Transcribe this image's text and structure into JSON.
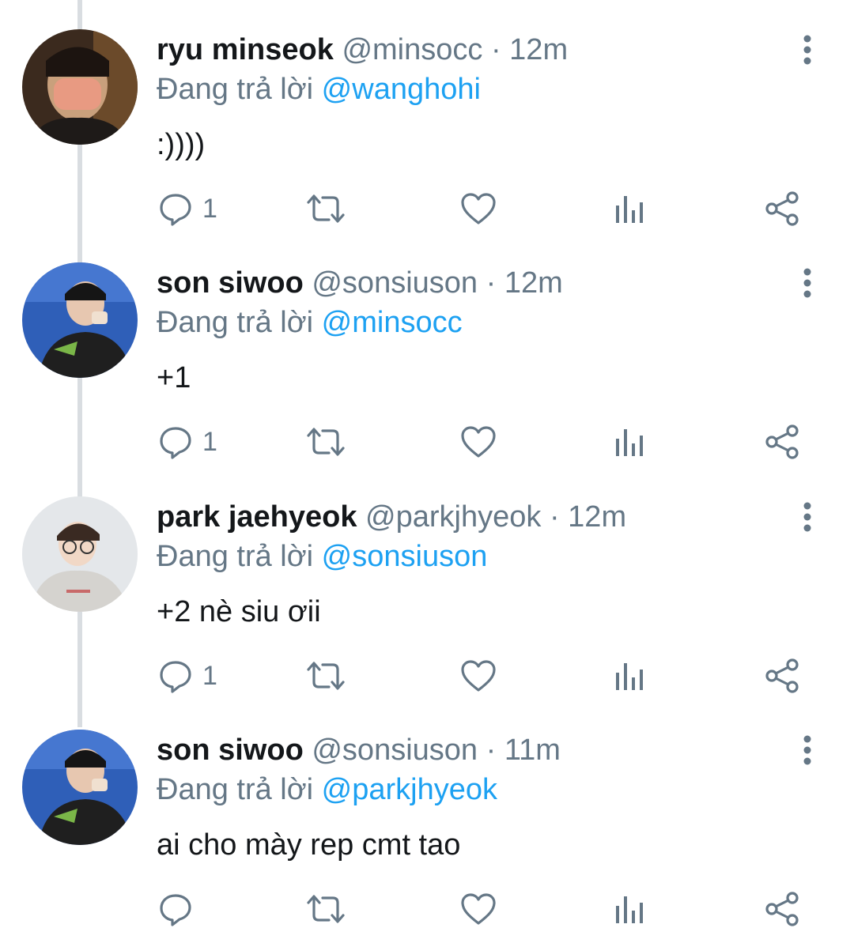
{
  "tweets": [
    {
      "name": "ryu minseok",
      "handle": "@minsocc",
      "sep": "·",
      "time": "12m",
      "reply_prefix": "Đang trả lời",
      "reply_to": "@wanghohi",
      "text": ":))))",
      "reply_count": "1"
    },
    {
      "name": "son siwoo",
      "handle": "@sonsiuson",
      "sep": "·",
      "time": "12m",
      "reply_prefix": "Đang trả lời",
      "reply_to": "@minsocc",
      "text": "+1",
      "reply_count": "1"
    },
    {
      "name": "park jaehyeok",
      "handle": "@parkjhyeok",
      "sep": "·",
      "time": "12m",
      "reply_prefix": "Đang trả lời",
      "reply_to": "@sonsiuson",
      "text": "+2 nè siu ơii",
      "reply_count": "1"
    },
    {
      "name": "son siwoo",
      "handle": "@sonsiuson",
      "sep": "·",
      "time": "11m",
      "reply_prefix": "Đang trả lời",
      "reply_to": "@parkjhyeok",
      "text": "ai cho mày rep cmt tao",
      "reply_count": ""
    }
  ],
  "icons": {
    "reply": "reply-icon",
    "retweet": "retweet-icon",
    "like": "like-icon",
    "analytics": "analytics-icon",
    "share": "share-icon",
    "more": "more-vertical-icon"
  },
  "colors": {
    "text": "#14171a",
    "secondary": "#657786",
    "accent": "#1da1f2",
    "thread_line": "#d9dde1"
  }
}
